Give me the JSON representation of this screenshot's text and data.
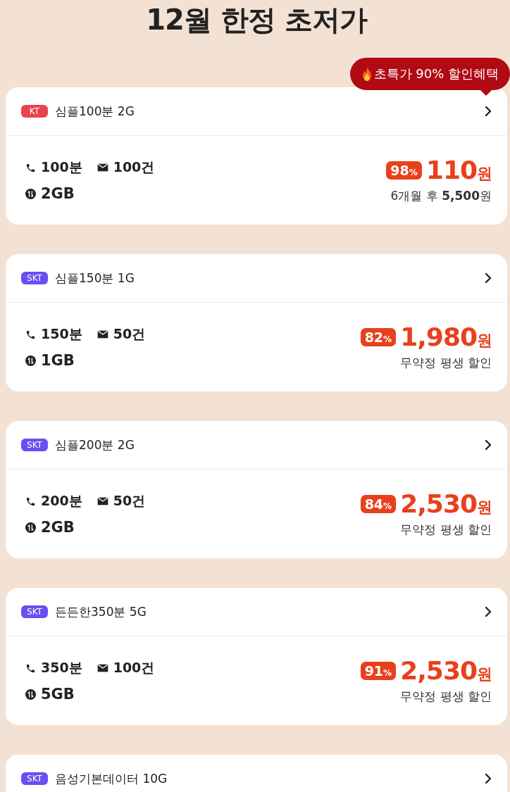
{
  "title": "12월 한정 초저가",
  "promo_badge": {
    "text": "초특가 90% 할인혜택"
  },
  "plans": [
    {
      "carrier": {
        "name": "KT",
        "color": "#e8434f"
      },
      "name": "심플100분 2G",
      "calls": "100분",
      "texts": "100건",
      "data": "2GB",
      "discount": "98",
      "discount_unit": "%",
      "amount": "110",
      "unit": "원",
      "note": "6개월 후 **5,500**원",
      "promo": true
    },
    {
      "carrier": {
        "name": "SKT",
        "color": "#6b4df2"
      },
      "name": "심플150분 1G",
      "calls": "150분",
      "texts": "50건",
      "data": "1GB",
      "discount": "82",
      "discount_unit": "%",
      "amount": "1,980",
      "unit": "원",
      "note": "무약정 평생 할인",
      "promo": false
    },
    {
      "carrier": {
        "name": "SKT",
        "color": "#6b4df2"
      },
      "name": "심플200분 2G",
      "calls": "200분",
      "texts": "50건",
      "data": "2GB",
      "discount": "84",
      "discount_unit": "%",
      "amount": "2,530",
      "unit": "원",
      "note": "무약정 평생 할인",
      "promo": false
    },
    {
      "carrier": {
        "name": "SKT",
        "color": "#6b4df2"
      },
      "name": "든든한350분 5G",
      "calls": "350분",
      "texts": "100건",
      "data": "5GB",
      "discount": "91",
      "discount_unit": "%",
      "amount": "2,530",
      "unit": "원",
      "note": "무약정 평생 할인",
      "promo": false
    },
    {
      "carrier": {
        "name": "SKT",
        "color": "#6b4df2"
      },
      "name": "음성기본데이터 10G",
      "promo": false
    }
  ]
}
